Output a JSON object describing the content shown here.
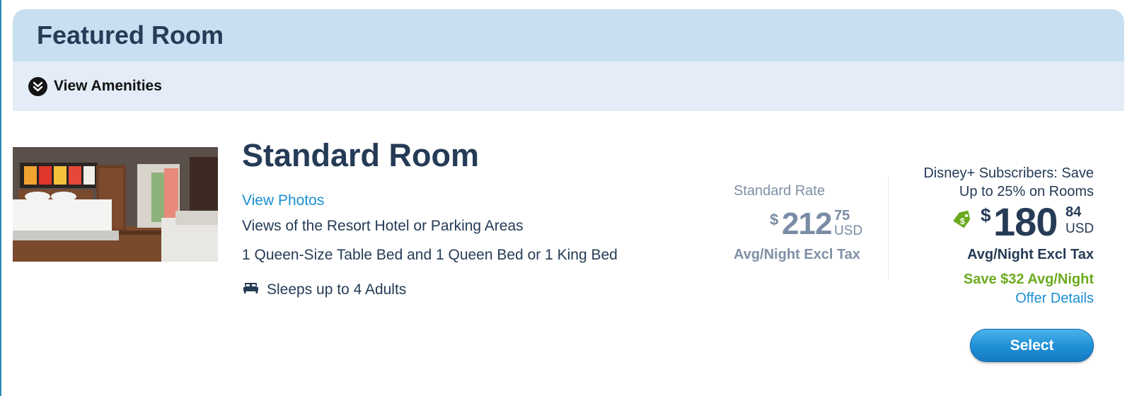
{
  "header": {
    "title": "Featured Room"
  },
  "amenities": {
    "toggle_label": "View Amenities",
    "icon": "double-chevron-down-icon"
  },
  "room": {
    "name": "Standard Room",
    "view_photos_label": "View Photos",
    "view": "Views of the Resort Hotel or Parking Areas",
    "beds": "1 Queen-Size Table Bed and 1 Queen Bed or 1 King Bed",
    "sleeps_icon": "bed-icon",
    "sleeps": "Sleeps up to 4 Adults"
  },
  "standard_rate": {
    "label": "Standard Rate",
    "currency_symbol": "$",
    "dollars": "212",
    "cents": "75",
    "currency": "USD",
    "per_night": "Avg/Night Excl Tax"
  },
  "promo_rate": {
    "offer": "Disney+ Subscribers: Save Up to 25% on Rooms",
    "tag_icon": "price-tag-icon",
    "currency_symbol": "$",
    "dollars": "180",
    "cents": "84",
    "currency": "USD",
    "per_night": "Avg/Night Excl Tax",
    "savings": "Save $32 Avg/Night",
    "offer_details_label": "Offer Details"
  },
  "actions": {
    "select_label": "Select"
  },
  "colors": {
    "header_bg": "#c7dff1",
    "amenities_bg": "#e4edf7",
    "navy_text": "#253b56",
    "link_blue": "#1a8fd1",
    "savings_green": "#6bab1f",
    "muted_gray": "#7f90a6",
    "button_blue": "#1f8fd6"
  }
}
